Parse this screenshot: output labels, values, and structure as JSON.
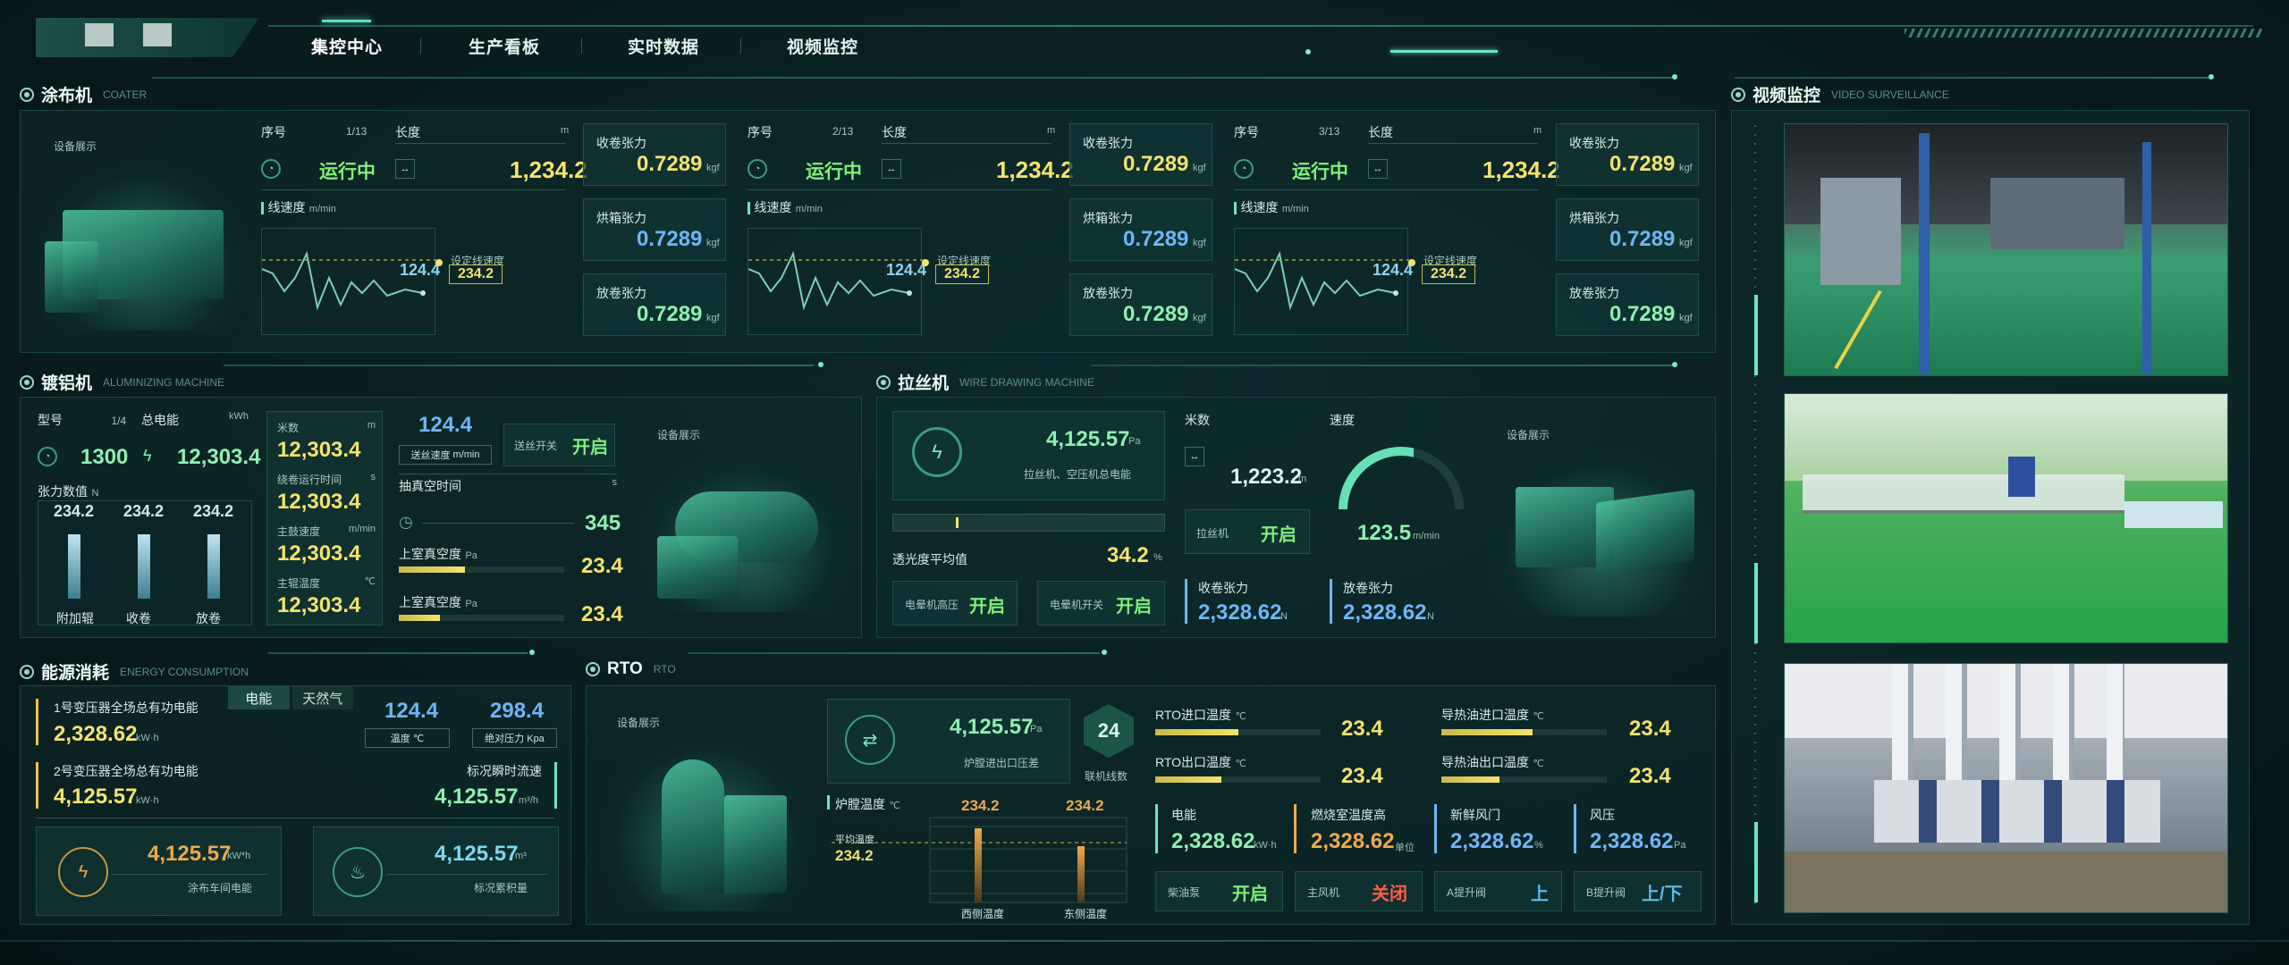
{
  "nav": {
    "items": [
      "集控中心",
      "生产看板",
      "实时数据",
      "视频监控"
    ],
    "active": 0
  },
  "coater": {
    "title": "涂布机",
    "title_en": "COATER",
    "show_label": "设备展示",
    "units": [
      {
        "seq_label": "序号",
        "seq": "1/13",
        "status": "运行中",
        "length_label": "长度",
        "length_unit": "m",
        "length": "1,234.2",
        "speed_label": "线速度",
        "speed_unit": "m/min",
        "current": "124.4",
        "set_label": "设定线速度",
        "set_value": "234.2",
        "tensions": [
          {
            "label": "收卷张力",
            "value": "0.7289",
            "unit": "kgf",
            "color": "yellow"
          },
          {
            "label": "烘箱张力",
            "value": "0.7289",
            "unit": "kgf",
            "color": "blue"
          },
          {
            "label": "放卷张力",
            "value": "0.7289",
            "unit": "kgf",
            "color": "green"
          }
        ]
      },
      {
        "seq_label": "序号",
        "seq": "2/13",
        "status": "运行中",
        "length_label": "长度",
        "length_unit": "m",
        "length": "1,234.2",
        "speed_label": "线速度",
        "speed_unit": "m/min",
        "current": "124.4",
        "set_label": "设定线速度",
        "set_value": "234.2",
        "tensions": [
          {
            "label": "收卷张力",
            "value": "0.7289",
            "unit": "kgf",
            "color": "yellow"
          },
          {
            "label": "烘箱张力",
            "value": "0.7289",
            "unit": "kgf",
            "color": "blue"
          },
          {
            "label": "放卷张力",
            "value": "0.7289",
            "unit": "kgf",
            "color": "green"
          }
        ]
      },
      {
        "seq_label": "序号",
        "seq": "3/13",
        "status": "运行中",
        "length_label": "长度",
        "length_unit": "m",
        "length": "1,234.2",
        "speed_label": "线速度",
        "speed_unit": "m/min",
        "current": "124.4",
        "set_label": "设定线速度",
        "set_value": "234.2",
        "tensions": [
          {
            "label": "收卷张力",
            "value": "0.7289",
            "unit": "kgf",
            "color": "yellow"
          },
          {
            "label": "烘箱张力",
            "value": "0.7289",
            "unit": "kgf",
            "color": "blue"
          },
          {
            "label": "放卷张力",
            "value": "0.7289",
            "unit": "kgf",
            "color": "green"
          }
        ]
      }
    ]
  },
  "alum": {
    "title": "镀铝机",
    "title_en": "ALUMINIZING MACHINE",
    "show_label": "设备展示",
    "model_label": "型号",
    "model_page": "1/4",
    "model": "1300",
    "power_label": "总电能",
    "power_unit": "kWh",
    "power": "12,303.4",
    "tension_label": "张力数值",
    "tension_unit": "N",
    "bars": [
      {
        "value": "234.2",
        "label": "附加辊"
      },
      {
        "value": "234.2",
        "label": "收卷"
      },
      {
        "value": "234.2",
        "label": "放卷"
      }
    ],
    "meters_label": "米数",
    "meters_unit": "m",
    "meters": "12,303.4",
    "runtime_label": "绕卷运行时间",
    "runtime_unit": "s",
    "runtime": "12,303.4",
    "drum_label": "主鼓速度",
    "drum_unit": "m/min",
    "drum": "12,303.4",
    "roll_label": "主辊温度",
    "roll_unit": "℃",
    "roll": "12,303.4",
    "feed_value": "124.4",
    "feed_label": "送丝速度",
    "feed_unit": "m/min",
    "switch_label": "送丝开关",
    "switch_state": "开启",
    "vac_label": "抽真空时间",
    "vac_unit": "s",
    "vac": "345",
    "upper1_label": "上室真空度",
    "upper1_unit": "Pa",
    "upper1": "23.4",
    "upper2_label": "上室真空度",
    "upper2_unit": "Pa",
    "upper2": "23.4"
  },
  "wire": {
    "title": "拉丝机",
    "title_en": "WIRE DRAWING MACHINE",
    "show_label": "设备展示",
    "power_value": "4,125.57",
    "power_unit": "Pa",
    "power_label": "拉丝机、空压机总电能",
    "trans_label": "透光度平均值",
    "trans": "34.2",
    "trans_unit": "%",
    "corona_hv_label": "电晕机高压",
    "corona_hv": "开启",
    "corona_sw_label": "电晕机开关",
    "corona_sw": "开启",
    "meters_label": "米数",
    "meters": "1,223.2",
    "meters_unit": "m",
    "machine_label": "拉丝机",
    "machine_state": "开启",
    "speed_label": "速度",
    "speed": "123.5",
    "speed_unit": "m/min",
    "wind_label": "收卷张力",
    "wind": "2,328.62",
    "wind_unit": "N",
    "unwind_label": "放卷张力",
    "unwind": "2,328.62",
    "unwind_unit": "N"
  },
  "energy": {
    "title": "能源消耗",
    "title_en": "ENERGY CONSUMPTION",
    "tabs": [
      "电能",
      "天然气"
    ],
    "t1_label": "1号变压器全场总有功电能",
    "t1": "2,328.62",
    "t1_unit": "kW·h",
    "t2_label": "2号变压器全场总有功电能",
    "t2": "4,125.57",
    "t2_unit": "kW·h",
    "temp_value": "124.4",
    "temp_label": "温度 ℃",
    "press_value": "298.4",
    "press_label": "绝对压力 Kpa",
    "flow_label": "标况瞬时流速",
    "flow": "4,125.57",
    "flow_unit": "m³/h",
    "workshop_value": "4,125.57",
    "workshop_unit": "kW*h",
    "workshop_label": "涂布车间电能",
    "accum_value": "4,125.57",
    "accum_unit": "m³",
    "accum_label": "标况累积量"
  },
  "rto": {
    "title": "RTO",
    "title_en": "RTO",
    "show_label": "设备展示",
    "press_value": "4,125.57",
    "press_unit": "Pa",
    "press_label": "炉膛进出口压差",
    "lines_value": "24",
    "lines_label": "联机线数",
    "furnace_label": "炉膛温度",
    "furnace_unit": "℃",
    "avg_label": "平均温度",
    "avg_value": "234.2",
    "west_value": "234.2",
    "west_label": "西侧温度",
    "east_value": "234.2",
    "east_label": "东侧温度",
    "in_temp_label": "RTO进口温度",
    "in_temp_unit": "℃",
    "in_temp": "23.4",
    "out_temp_label": "RTO出口温度",
    "out_temp_unit": "℃",
    "out_temp": "23.4",
    "oil_in_label": "导热油进口温度",
    "oil_in_unit": "℃",
    "oil_in": "23.4",
    "oil_out_label": "导热油出口温度",
    "oil_out_unit": "℃",
    "oil_out": "23.4",
    "power_label": "电能",
    "power": "2,328.62",
    "power_unit": "kW·h",
    "burn_label": "燃烧室温度高",
    "burn": "2,328.62",
    "burn_unit": "单位",
    "fresh_label": "新鲜风门",
    "fresh": "2,328.62",
    "fresh_unit": "%",
    "fan_label": "风压",
    "fan": "2,328.62",
    "fan_unit": "Pa",
    "pump_label": "柴油泵",
    "pump_state": "开启",
    "mainfan_label": "主风机",
    "mainfan_state": "关闭",
    "a_label": "A提升阀",
    "a_state": "上",
    "b_label": "B提升阀",
    "b_state": "上/下"
  },
  "video": {
    "title": "视频监控",
    "title_en": "VIDEO SURVEILLANCE"
  }
}
